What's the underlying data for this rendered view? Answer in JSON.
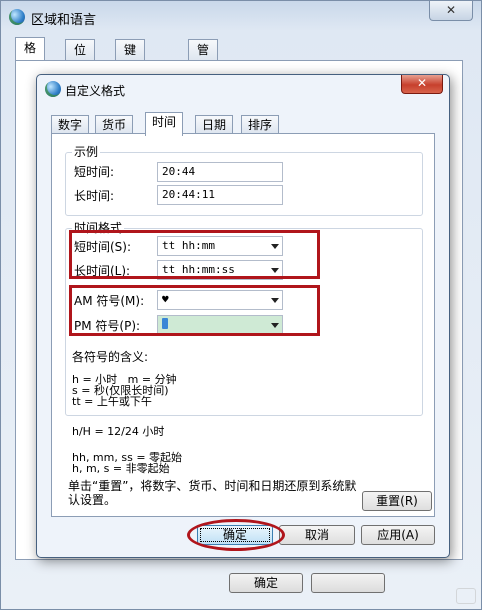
{
  "outer_window": {
    "title": "区域和语言",
    "close_label": "✕",
    "tabs": [
      "格式",
      "位置",
      "键盘和语言",
      "管理"
    ],
    "ok_label": "确定"
  },
  "dialog": {
    "title": "自定义格式",
    "close_label": "✕",
    "tabs": [
      "数字",
      "货币",
      "时间",
      "日期",
      "排序"
    ],
    "active_tab": "时间",
    "example": {
      "legend": "示例",
      "short_time_label": "短时间:",
      "short_time_value": "20:44",
      "long_time_label": "长时间:",
      "long_time_value": "20:44:11"
    },
    "time_formats": {
      "legend": "时间格式",
      "short_time_label": "短时间(S):",
      "short_time_value": "tt hh:mm",
      "long_time_label": "长时间(L):",
      "long_time_value": "tt hh:mm:ss",
      "am_label": "AM 符号(M):",
      "am_value": "♥",
      "pm_label": "PM 符号(P):",
      "pm_value": ""
    },
    "symbols": {
      "heading": "各符号的含义:",
      "lines": [
        "h = 小时   m = 分钟",
        "s = 秒(仅限长时间)",
        "tt = 上午或下午",
        "",
        "h/H = 12/24 小时",
        "",
        "hh, mm, ss = 零起始",
        "h, m, s = 非零起始"
      ]
    },
    "reset_note": "单击“重置”，将数字、货币、时间和日期还原到系统默认设置。",
    "reset_label": "重置(R)",
    "ok_label": "确定",
    "cancel_label": "取消",
    "apply_label": "应用(A)"
  },
  "colors": {
    "highlight_red": "#b0151b",
    "selected_field": "#cfead5",
    "window_frame": "#46607f"
  }
}
